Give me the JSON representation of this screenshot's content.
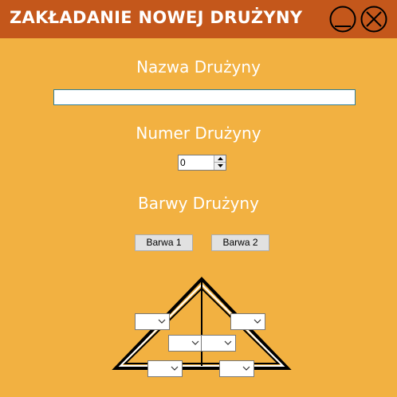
{
  "window": {
    "title": "ZAKŁADANIE NOWEJ DRUŻYNY",
    "minimize_icon": "minimize-icon",
    "close_icon": "close-icon"
  },
  "team_name": {
    "label": "Nazwa Drużyny",
    "value": ""
  },
  "team_number": {
    "label": "Numer Drużyny",
    "value": "0"
  },
  "team_colors": {
    "label": "Barwy Drużyny",
    "color1_label": "Barwa 1",
    "color2_label": "Barwa 2"
  },
  "colors": {
    "titlebar": "#C4571B",
    "background": "#F2B141",
    "text": "#FFFFFF"
  }
}
